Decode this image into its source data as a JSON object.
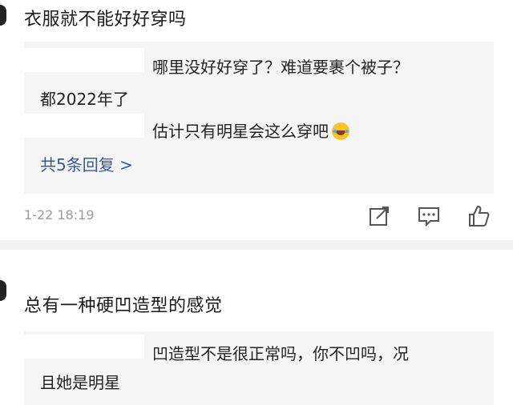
{
  "comments": [
    {
      "text": "衣服就不能好好穿吗",
      "replies": [
        "哪里没好好穿了？难道要裹个被子？",
        "都2022年了",
        "估计只有明星会这么穿吧"
      ],
      "more_replies": "共5条回复 >",
      "time": "1-22 18:19",
      "actions": [
        "share-icon",
        "comment-icon",
        "like-icon"
      ]
    },
    {
      "text": "总有一种硬凹造型的感觉",
      "replies": [
        "凹造型不是很正常吗，你不凹吗，况",
        "且她是明星"
      ]
    }
  ],
  "colors": {
    "link": "#3b5a8a",
    "reply_bg": "#f5f5f5",
    "meta": "#9a9a9a"
  }
}
